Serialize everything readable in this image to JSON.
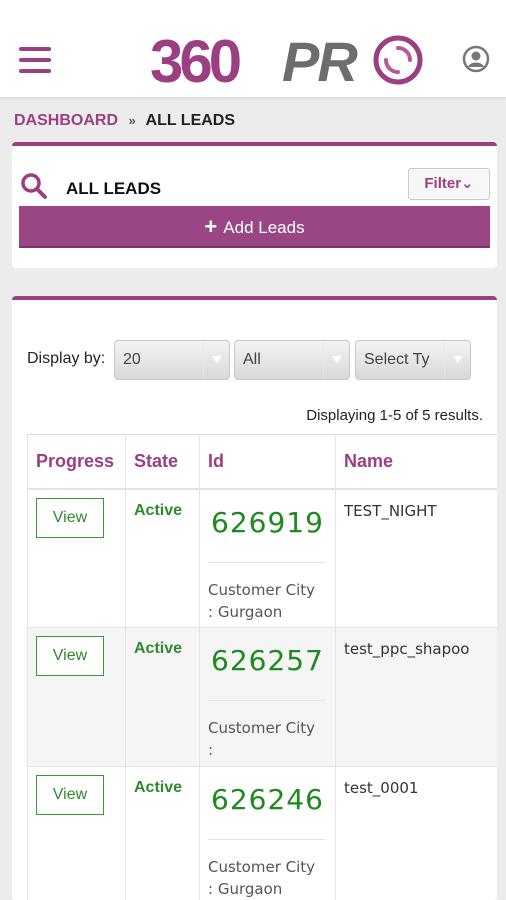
{
  "header": {
    "logo_360": "360",
    "logo_pro": "PR",
    "menu_icon": "hamburger-icon",
    "user_icon": "user-icon"
  },
  "breadcrumb": {
    "home": "DASHBOARD",
    "separator": "»",
    "current": "ALL LEADS"
  },
  "leads_card": {
    "title": "ALL LEADS",
    "filter_label": "Filter⌄",
    "add_label": "Add Leads",
    "search_icon": "search-icon"
  },
  "list": {
    "display_label": "Display by:",
    "page_size": "20",
    "status_filter": "All",
    "type_filter": "Select Ty",
    "results_text": "Displaying 1-5 of 5 results."
  },
  "table": {
    "headers": [
      "Progress",
      "State",
      "Id",
      "Name"
    ],
    "rows": [
      {
        "view": "View",
        "state": "Active",
        "id": "626919",
        "city_label": "Customer City",
        "city_value": ": Gurgaon",
        "name": "TEST_NIGHT"
      },
      {
        "view": "View",
        "state": "Active",
        "id": "626257",
        "city_label": "Customer City",
        "city_value": ":",
        "name": "test_ppc_shapoo"
      },
      {
        "view": "View",
        "state": "Active",
        "id": "626246",
        "city_label": "Customer City",
        "city_value": ": Gurgaon",
        "name": "test_0001"
      }
    ]
  },
  "colors": {
    "brand": "#9b3f82",
    "active": "#2e8a2e",
    "logo_grey": "#6d6d6d"
  }
}
